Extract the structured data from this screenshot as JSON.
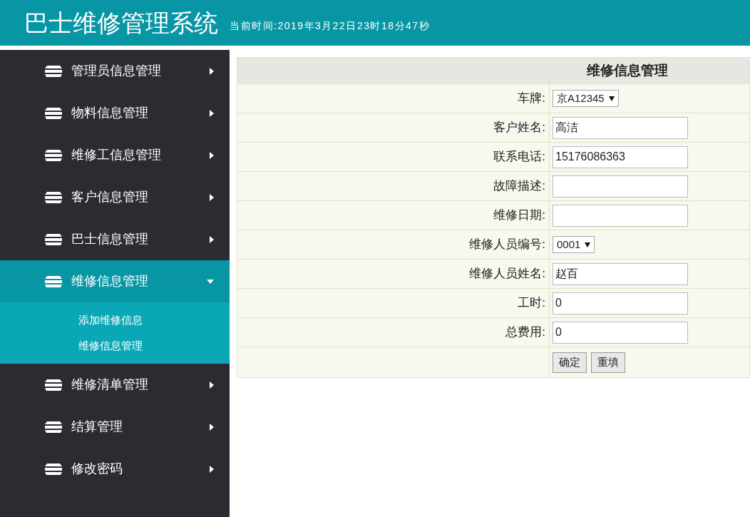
{
  "header": {
    "title": "巴士维修管理系统",
    "clock": "当前时间:2019年3月22日23时18分47秒"
  },
  "sidebar": {
    "items": [
      {
        "label": "管理员信息管理",
        "expanded": false
      },
      {
        "label": "物料信息管理",
        "expanded": false
      },
      {
        "label": "维修工信息管理",
        "expanded": false
      },
      {
        "label": "客户信息管理",
        "expanded": false
      },
      {
        "label": "巴士信息管理",
        "expanded": false
      },
      {
        "label": "维修信息管理",
        "expanded": true,
        "children": [
          {
            "label": "添加维修信息"
          },
          {
            "label": "维修信息管理"
          }
        ]
      },
      {
        "label": "维修清单管理",
        "expanded": false
      },
      {
        "label": "结算管理",
        "expanded": false
      },
      {
        "label": "修改密码",
        "expanded": false
      }
    ]
  },
  "form": {
    "title": "维修信息管理",
    "fields": [
      {
        "label": "车牌:",
        "kind": "select",
        "value": "京A12345"
      },
      {
        "label": "客户姓名:",
        "kind": "text",
        "value": "高洁"
      },
      {
        "label": "联系电话:",
        "kind": "text",
        "value": "15176086363"
      },
      {
        "label": "故障描述:",
        "kind": "text"
      },
      {
        "label": "维修日期:",
        "kind": "text"
      },
      {
        "label": "维修人员编号:",
        "kind": "select",
        "value": "0001"
      },
      {
        "label": "维修人员姓名:",
        "kind": "text",
        "value": "赵百"
      },
      {
        "label": "工时:",
        "kind": "text",
        "value": "0"
      },
      {
        "label": "总费用:",
        "kind": "text",
        "value": "0"
      }
    ],
    "buttons": [
      "确定",
      "重填"
    ]
  }
}
